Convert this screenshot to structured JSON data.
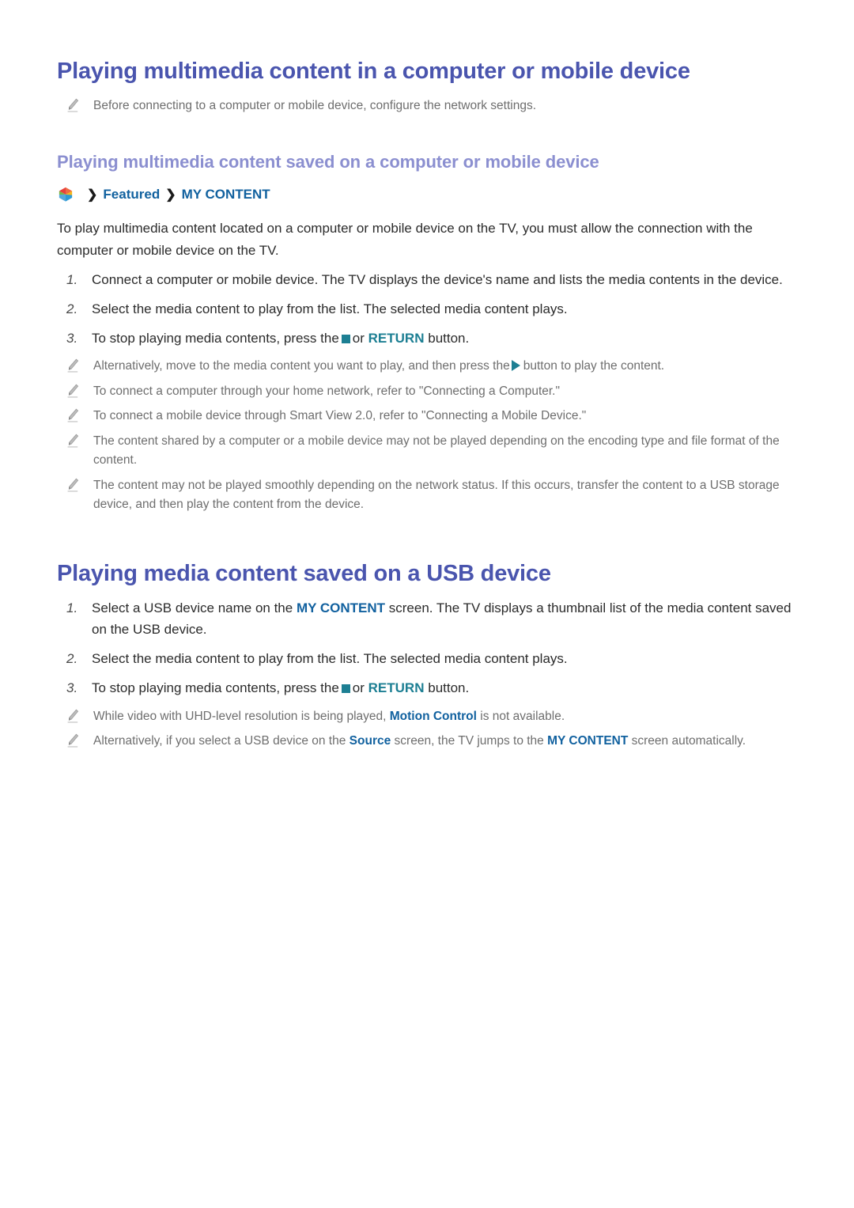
{
  "page": {
    "section1": {
      "heading": "Playing multimedia content in a computer or mobile device",
      "intro_note": "Before connecting to a computer or mobile device, configure the network settings.",
      "subheading": "Playing multimedia content saved on a computer or mobile device",
      "breadcrumb": {
        "icon": "smart-hub-icon",
        "separator": "❯",
        "item1": "Featured",
        "item2": "MY CONTENT"
      },
      "paragraph": "To play multimedia content located on a computer or mobile device on the TV, you must allow the connection with the computer or mobile device on the TV.",
      "steps": [
        {
          "num": "1.",
          "text": "Connect a computer or mobile device. The TV displays the device's name and lists the media contents in the device."
        },
        {
          "num": "2.",
          "text": "Select the media content to play from the list. The selected media content plays."
        },
        {
          "num": "3.",
          "prefix": "To stop playing media contents, press the",
          "stop_icon": "stop-square-icon",
          "middle": "or",
          "keyword": "RETURN",
          "suffix": "button."
        }
      ],
      "notes": [
        {
          "prefix": "Alternatively, move to the media content you want to play, and then press the",
          "play_icon": "play-triangle-icon",
          "suffix": "button to play the content."
        },
        {
          "text": "To connect a computer through your home network, refer to \"Connecting a Computer.\""
        },
        {
          "text": "To connect a mobile device through Smart View 2.0, refer to \"Connecting a Mobile Device.\""
        },
        {
          "text": "The content shared by a computer or a mobile device may not be played depending on the encoding type and file format of the content."
        },
        {
          "text": "The content may not be played smoothly depending on the network status. If this occurs, transfer the content to a USB storage device, and then play the content from the device."
        }
      ]
    },
    "section2": {
      "heading": "Playing media content saved on a USB device",
      "steps": [
        {
          "num": "1.",
          "prefix": "Select a USB device name on the",
          "keyword": "MY CONTENT",
          "suffix": "screen. The TV displays a thumbnail list of the media content saved on the USB device."
        },
        {
          "num": "2.",
          "text": "Select the media content to play from the list. The selected media content plays."
        },
        {
          "num": "3.",
          "prefix": "To stop playing media contents, press the",
          "stop_icon": "stop-square-icon",
          "middle": "or",
          "keyword": "RETURN",
          "suffix": "button."
        }
      ],
      "notes": [
        {
          "prefix": "While video with UHD-level resolution is being played,",
          "keyword": "Motion Control",
          "suffix": "is not available."
        },
        {
          "prefix": "Alternatively, if you select a USB device on the",
          "keyword1": "Source",
          "middle": "screen, the TV jumps to the",
          "keyword2": "MY CONTENT",
          "suffix": "screen automatically."
        }
      ]
    }
  },
  "colors": {
    "h1": "#4a55ae",
    "h2": "#8b8fd0",
    "link_blue": "#11619f",
    "accent_teal": "#1d7f93",
    "body_text": "#2b2b2b",
    "note_text": "#6e6e6e"
  }
}
